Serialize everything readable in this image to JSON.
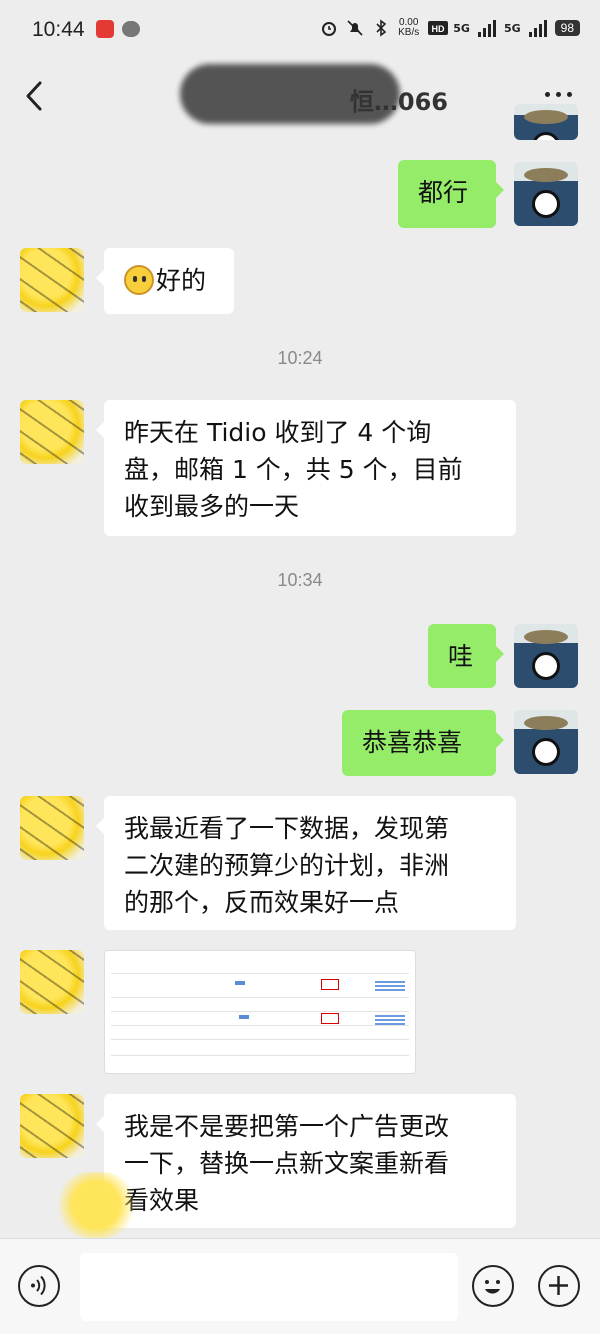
{
  "status_bar": {
    "time": "10:44",
    "net_speed": "0.00\nKB/s",
    "network_1": "5G",
    "network_2": "5G",
    "battery": "98"
  },
  "nav": {
    "title": "恒…066",
    "back_icon": "chevron-left-icon",
    "more_icon": "more-icon"
  },
  "messages": [
    {
      "side": "right",
      "type": "text",
      "text": "都行"
    },
    {
      "side": "left",
      "type": "text",
      "emoji": "dizzy-face-emoji",
      "text": "好的"
    },
    {
      "type": "time",
      "text": "10:24"
    },
    {
      "side": "left",
      "type": "text",
      "lines": [
        "昨天在 Tidio 收到了 4 个询",
        "盘，邮箱 1 个，共 5 个，目前",
        "收到最多的一天"
      ]
    },
    {
      "type": "time",
      "text": "10:34"
    },
    {
      "side": "right",
      "type": "text",
      "text": "哇"
    },
    {
      "side": "right",
      "type": "text",
      "text": "恭喜恭喜"
    },
    {
      "side": "left",
      "type": "text",
      "lines": [
        "我最近看了一下数据，发现第",
        "二次建的预算少的计划，非洲",
        "的那个，反而效果好一点"
      ]
    },
    {
      "side": "left",
      "type": "image",
      "description_icon": "spreadsheet-screenshot"
    },
    {
      "side": "left",
      "type": "text",
      "lines": [
        "我是不是要把第一个广告更改",
        "一下，替换一点新文案重新看",
        "看效果"
      ]
    }
  ],
  "input_bar": {
    "voice_icon": "voice-icon",
    "emoji_icon": "emoji-icon",
    "plus_icon": "plus-icon",
    "placeholder": ""
  },
  "colors": {
    "background": "#ededed",
    "bubble_right": "#95ec69",
    "bubble_left": "#ffffff"
  }
}
